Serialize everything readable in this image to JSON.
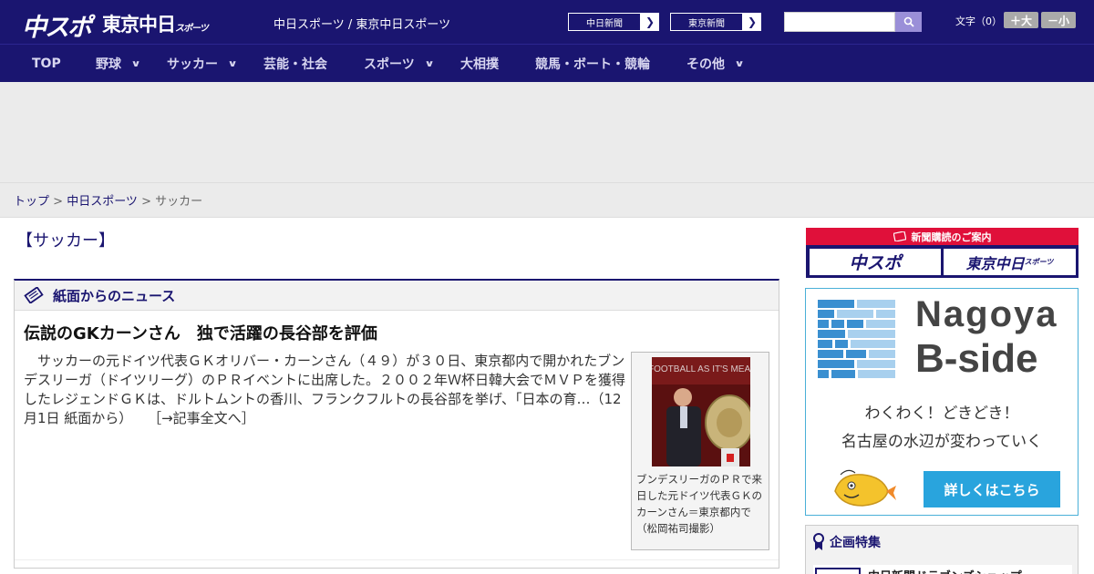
{
  "header": {
    "logo_main": "中スポ",
    "logo_tokyo": "東京中日",
    "logo_tokyo_small": "スポーツ",
    "site_tag": "中日スポーツ / 東京中日スポーツ",
    "ext_links": [
      "中日新聞",
      "東京新聞"
    ],
    "search_placeholder": "",
    "font_size_label": "文字（0）",
    "font_bigger": "＋大",
    "font_smaller": "－小"
  },
  "nav": {
    "items": [
      "TOP",
      "野球",
      "サッカー",
      "芸能・社会",
      "スポーツ",
      "大相撲",
      "競馬・ボート・競輪",
      "その他"
    ]
  },
  "breadcrumb": {
    "home": "トップ",
    "parent": "中日スポーツ",
    "current": "サッカー"
  },
  "section": {
    "title": "【サッカー】"
  },
  "news": {
    "box_title": "紙面からのニュース",
    "headline": "伝説のGKカーンさん　独で活躍の長谷部を評価",
    "body": "サッカーの元ドイツ代表ＧＫオリバー・カーンさん（４９）が３０日、東京都内で開かれたブンデスリーガ（ドイツリーグ）のＰＲイベントに出席した。２００２年Ｗ杯日韓大会でＭＶＰを獲得したレジェンドＧＫは、ドルトムントの香川、フランクフルトの長谷部を挙げ、「日本の育…（12月1日 紙面から）",
    "more_link": "［→記事全文へ］",
    "caption": "ブンデスリーガのＰＲで来日した元ドイツ代表ＧＫのカーンさん＝東京都内で（松岡祐司撮影）",
    "photo_text": "FOOTBALL AS IT'S MEANT"
  },
  "sidebar": {
    "subscribe_head": "新聞購読のご案内",
    "subscribe_left": "中スポ",
    "subscribe_right": "東京中日",
    "subscribe_right_small": "スポーツ",
    "bside_word1": "Nagoya",
    "bside_word2": "B-side",
    "bside_copy1": "わくわく！どきどき！",
    "bside_copy2": "名古屋の水辺が変わっていく",
    "bside_cta": "詳しくはこちら",
    "feature_title": "企画特集",
    "feature_item": "中日新聞ドラゴンズショップ"
  },
  "colors": {
    "brand": "#1a1570",
    "accent_red": "#e0103a",
    "bside_blue": "#29a4dd"
  }
}
